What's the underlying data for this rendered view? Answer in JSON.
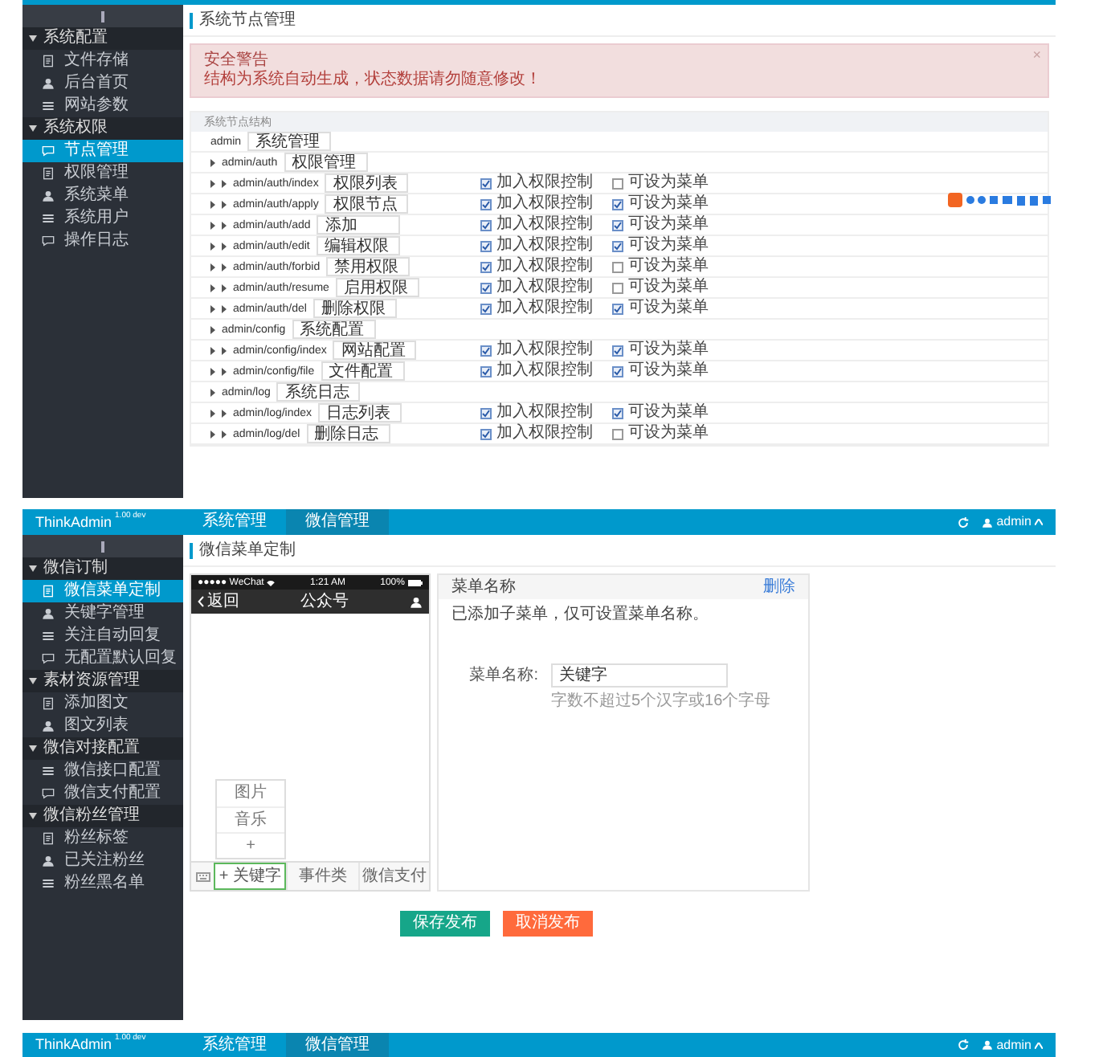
{
  "node_screen": {
    "sidebar": {
      "groups": [
        {
          "title": "系统配置",
          "items": [
            {
              "label": "文件存储",
              "selected": false
            },
            {
              "label": "后台首页",
              "selected": false
            },
            {
              "label": "网站参数",
              "selected": false
            }
          ]
        },
        {
          "title": "系统权限",
          "items": [
            {
              "label": "节点管理",
              "selected": true
            },
            {
              "label": "权限管理",
              "selected": false
            },
            {
              "label": "系统菜单",
              "selected": false
            },
            {
              "label": "系统用户",
              "selected": false
            },
            {
              "label": "操作日志",
              "selected": false
            }
          ]
        }
      ]
    },
    "breadcrumb": "系统节点管理",
    "alert": {
      "title": "安全警告",
      "message": "结构为系统自动生成，状态数据请勿随意修改！",
      "close": "×"
    },
    "tree": {
      "heading": "系统节点结构",
      "nodes": [
        {
          "node": "admin",
          "title": "系统管理",
          "children": [
            {
              "node": "admin/auth",
              "title": "权限管理",
              "children": [
                {
                  "node": "admin/auth/index",
                  "title": "权限列表",
                  "auth": {
                    "label": "加入权限控制",
                    "checked": true
                  },
                  "menu": {
                    "label": "可设为菜单",
                    "checked": false
                  }
                },
                {
                  "node": "admin/auth/apply",
                  "title": "权限节点",
                  "auth": {
                    "label": "加入权限控制",
                    "checked": true
                  },
                  "menu": {
                    "label": "可设为菜单",
                    "checked": true
                  }
                },
                {
                  "node": "admin/auth/add",
                  "title": "添加",
                  "auth": {
                    "label": "加入权限控制",
                    "checked": true
                  },
                  "menu": {
                    "label": "可设为菜单",
                    "checked": true
                  }
                },
                {
                  "node": "admin/auth/edit",
                  "title": "编辑权限",
                  "auth": {
                    "label": "加入权限控制",
                    "checked": true
                  },
                  "menu": {
                    "label": "可设为菜单",
                    "checked": true
                  }
                },
                {
                  "node": "admin/auth/forbid",
                  "title": "禁用权限",
                  "auth": {
                    "label": "加入权限控制",
                    "checked": true
                  },
                  "menu": {
                    "label": "可设为菜单",
                    "checked": false
                  }
                },
                {
                  "node": "admin/auth/resume",
                  "title": "启用权限",
                  "auth": {
                    "label": "加入权限控制",
                    "checked": true
                  },
                  "menu": {
                    "label": "可设为菜单",
                    "checked": false
                  }
                },
                {
                  "node": "admin/auth/del",
                  "title": "删除权限",
                  "auth": {
                    "label": "加入权限控制",
                    "checked": true
                  },
                  "menu": {
                    "label": "可设为菜单",
                    "checked": true
                  }
                }
              ]
            },
            {
              "node": "admin/config",
              "title": "系统配置",
              "children": [
                {
                  "node": "admin/config/index",
                  "title": "网站配置",
                  "auth": {
                    "label": "加入权限控制",
                    "checked": true
                  },
                  "menu": {
                    "label": "可设为菜单",
                    "checked": true
                  }
                },
                {
                  "node": "admin/config/file",
                  "title": "文件配置",
                  "auth": {
                    "label": "加入权限控制",
                    "checked": true
                  },
                  "menu": {
                    "label": "可设为菜单",
                    "checked": true
                  }
                }
              ]
            },
            {
              "node": "admin/log",
              "title": "系统日志",
              "children": [
                {
                  "node": "admin/log/index",
                  "title": "日志列表",
                  "auth": {
                    "label": "加入权限控制",
                    "checked": true
                  },
                  "menu": {
                    "label": "可设为菜单",
                    "checked": true
                  }
                },
                {
                  "node": "admin/log/del",
                  "title": "删除日志",
                  "auth": {
                    "label": "加入权限控制",
                    "checked": true
                  },
                  "menu": {
                    "label": "可设为菜单",
                    "checked": false
                  }
                }
              ]
            }
          ]
        }
      ]
    }
  },
  "menu_screen": {
    "navbar": {
      "brand": "ThinkAdmin",
      "version": "1.00 dev",
      "tabs": [
        {
          "label": "系统管理",
          "selected": false
        },
        {
          "label": "微信管理",
          "selected": true
        }
      ],
      "user": "admin"
    },
    "sidebar": {
      "groups": [
        {
          "title": "微信订制",
          "items": [
            {
              "label": "微信菜单定制",
              "selected": true
            },
            {
              "label": "关键字管理",
              "selected": false
            },
            {
              "label": "关注自动回复",
              "selected": false
            },
            {
              "label": "无配置默认回复",
              "selected": false
            }
          ]
        },
        {
          "title": "素材资源管理",
          "items": [
            {
              "label": "添加图文",
              "selected": false
            },
            {
              "label": "图文列表",
              "selected": false
            }
          ]
        },
        {
          "title": "微信对接配置",
          "items": [
            {
              "label": "微信接口配置",
              "selected": false
            },
            {
              "label": "微信支付配置",
              "selected": false
            }
          ]
        },
        {
          "title": "微信粉丝管理",
          "items": [
            {
              "label": "粉丝标签",
              "selected": false
            },
            {
              "label": "已关注粉丝",
              "selected": false
            },
            {
              "label": "粉丝黑名单",
              "selected": false
            }
          ]
        }
      ]
    },
    "breadcrumb": "微信菜单定制",
    "phone": {
      "carrier": "●●●●● WeChat",
      "time": "1:21 AM",
      "battery": "100%",
      "back": "返回",
      "title": "公众号",
      "submenu": [
        "图片",
        "音乐",
        "+"
      ],
      "tabs": [
        {
          "label": "+ 关键字",
          "selected": true
        },
        {
          "label": "事件类",
          "selected": false
        },
        {
          "label": "微信支付",
          "selected": false
        }
      ]
    },
    "editor": {
      "heading": "菜单名称",
      "delete": "删除",
      "notice": "已添加子菜单，仅可设置菜单名称。",
      "field_label": "菜单名称:",
      "value": "关键字",
      "hint": "字数不超过5个汉字或16个字母"
    },
    "buttons": [
      {
        "label": "保存发布",
        "kind": "primary"
      },
      {
        "label": "取消发布",
        "kind": "danger"
      }
    ]
  },
  "bottom_screen": {
    "navbar": {
      "brand": "ThinkAdmin",
      "version": "1.00 dev",
      "tabs": [
        {
          "label": "系统管理",
          "selected": false
        },
        {
          "label": "微信管理",
          "selected": true
        }
      ],
      "user": "admin"
    }
  }
}
